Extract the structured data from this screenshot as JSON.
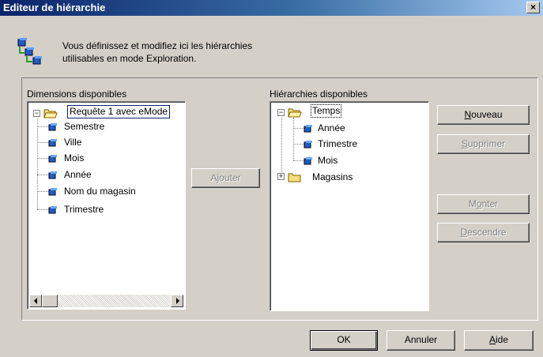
{
  "window": {
    "title": "Editeur de hiérarchie",
    "close_label": "×"
  },
  "intro": {
    "line1": "Vous définissez et modifiez ici les hiérarchies",
    "line2": "utilisables en mode Exploration.",
    "icon": "hierarchy-icon"
  },
  "dimensions": {
    "label": "Dimensions disponibles",
    "root": "Requête 1 avec eMode",
    "items": [
      "Semestre",
      "Ville",
      "Mois",
      "Année",
      "Nom du magasin",
      "Trimestre"
    ]
  },
  "add_button": "Ajouter",
  "hierarchies": {
    "label": "Hiérarchies disponibles",
    "groups": [
      {
        "name": "Temps",
        "children": [
          "Année",
          "Trimestre",
          "Mois"
        ]
      },
      {
        "name": "Magasins",
        "children": []
      }
    ]
  },
  "side_buttons": {
    "new": {
      "accel": "N",
      "rest": "ouveau"
    },
    "delete": {
      "accel": "S",
      "rest": "upprimer"
    },
    "up": {
      "prefix": "M",
      "accel": "o",
      "rest": "nter"
    },
    "down": {
      "accel": "D",
      "rest": "escendre"
    }
  },
  "footer": {
    "ok": "OK",
    "cancel": "Annuler",
    "help": {
      "accel": "A",
      "rest": "ide"
    }
  },
  "colors": {
    "title_start": "#0a246a",
    "title_end": "#a6caf0",
    "face": "#d4d0c8",
    "cube": "#1f5fbf",
    "folder": "#f4e07a"
  }
}
